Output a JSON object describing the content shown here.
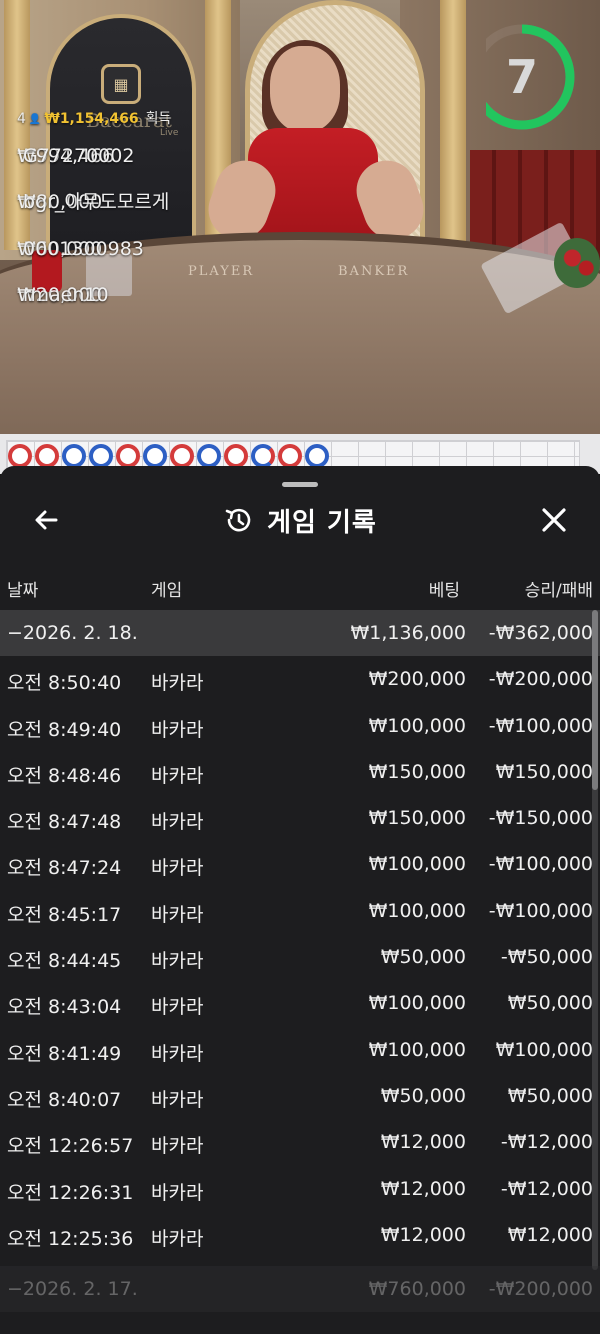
{
  "video": {
    "table_labels": {
      "player": "PLAYER",
      "banker": "BANKER"
    },
    "logo": {
      "word": "Baccarat",
      "live": "Live"
    },
    "timer": {
      "value": "7",
      "progress": 0.65,
      "color": "#22c55e"
    }
  },
  "winners": {
    "top": {
      "count": "4",
      "amount": "₩1,154,466",
      "suffix": "획득"
    },
    "list": [
      {
        "amount": "₩994,466",
        "user": "G77270002"
      },
      {
        "amount": "₩80,000",
        "user": "bgr_아무도모르게"
      },
      {
        "amount": "₩60,000",
        "user": "0001300983"
      },
      {
        "amount": "₩20,000",
        "user": "rmaen10"
      }
    ]
  },
  "road": {
    "beads": [
      "red",
      "red",
      "blue",
      "blue",
      "red",
      "blue",
      "red",
      "blue",
      "red",
      "blue-red",
      "red",
      "blue"
    ],
    "colors": {
      "red": "#d43b3b",
      "blue": "#2d5fc4"
    }
  },
  "sheet": {
    "title": "게임 기록",
    "back_icon": "arrow-left-icon",
    "history_icon": "history-icon",
    "close_icon": "close-icon",
    "columns": {
      "date": "날짜",
      "game": "게임",
      "bet": "베팅",
      "result": "승리/패배"
    },
    "date_group": {
      "date": "−2026. 2. 18.",
      "bet": "₩1,136,000",
      "result": "-₩362,000"
    },
    "rows": [
      {
        "time": "오전 8:50:40",
        "game": "바카라",
        "bet": "₩200,000",
        "result": "-₩200,000"
      },
      {
        "time": "오전 8:49:40",
        "game": "바카라",
        "bet": "₩100,000",
        "result": "-₩100,000"
      },
      {
        "time": "오전 8:48:46",
        "game": "바카라",
        "bet": "₩150,000",
        "result": "₩150,000"
      },
      {
        "time": "오전 8:47:48",
        "game": "바카라",
        "bet": "₩150,000",
        "result": "-₩150,000"
      },
      {
        "time": "오전 8:47:24",
        "game": "바카라",
        "bet": "₩100,000",
        "result": "-₩100,000"
      },
      {
        "time": "오전 8:45:17",
        "game": "바카라",
        "bet": "₩100,000",
        "result": "-₩100,000"
      },
      {
        "time": "오전 8:44:45",
        "game": "바카라",
        "bet": "₩50,000",
        "result": "-₩50,000"
      },
      {
        "time": "오전 8:43:04",
        "game": "바카라",
        "bet": "₩100,000",
        "result": "₩50,000"
      },
      {
        "time": "오전 8:41:49",
        "game": "바카라",
        "bet": "₩100,000",
        "result": "₩100,000"
      },
      {
        "time": "오전 8:40:07",
        "game": "바카라",
        "bet": "₩50,000",
        "result": "₩50,000"
      },
      {
        "time": "오전 12:26:57",
        "game": "바카라",
        "bet": "₩12,000",
        "result": "-₩12,000"
      },
      {
        "time": "오전 12:26:31",
        "game": "바카라",
        "bet": "₩12,000",
        "result": "-₩12,000"
      },
      {
        "time": "오전 12:25:36",
        "game": "바카라",
        "bet": "₩12,000",
        "result": "₩12,000"
      }
    ],
    "next_group": {
      "date": "−2026. 2. 17.",
      "bet": "₩760,000",
      "result": "-₩200,000"
    }
  }
}
